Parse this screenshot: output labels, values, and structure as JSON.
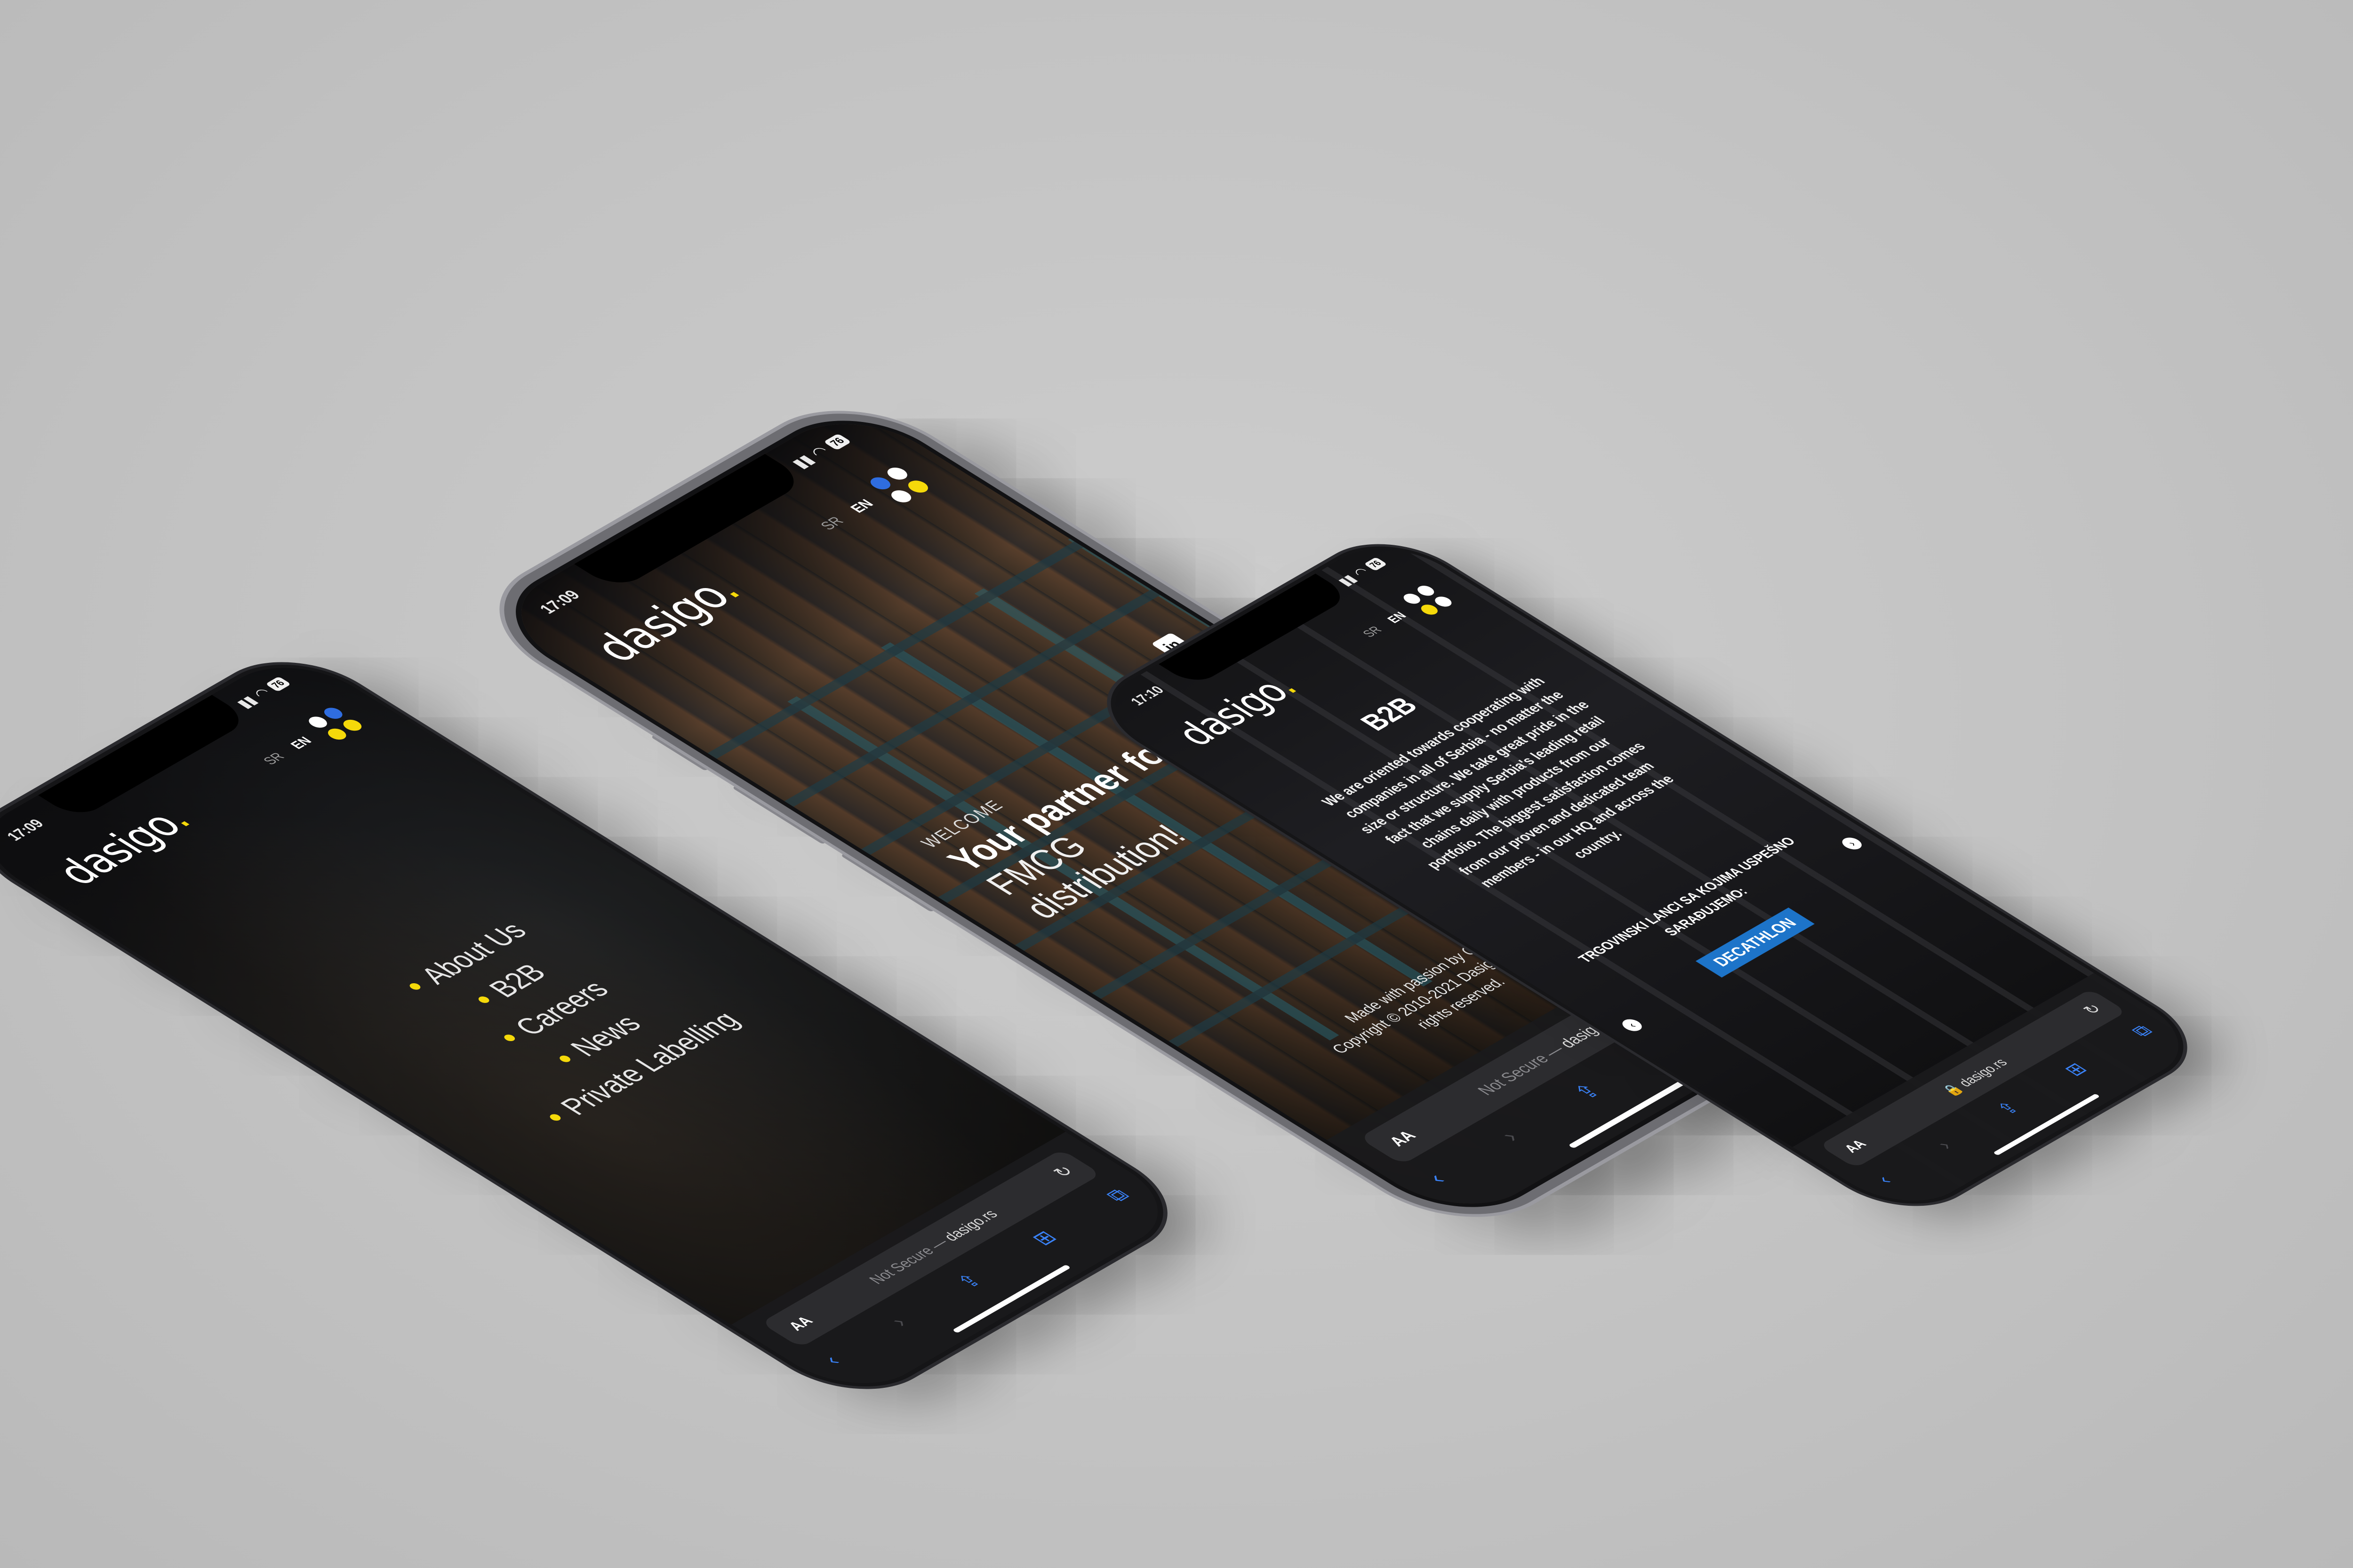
{
  "phones": [
    {
      "status": {
        "time": "17:09",
        "battery": "76"
      },
      "header": {
        "logo_text": "dasigo",
        "logo_dot": ".",
        "lang_sr": "SR",
        "lang_en": "EN"
      },
      "menu": {
        "items": [
          {
            "label": "About Us"
          },
          {
            "label": "B2B"
          },
          {
            "label": "Careers"
          },
          {
            "label": "News"
          },
          {
            "label": "Private Labelling"
          }
        ]
      },
      "safari": {
        "aa": "AA",
        "url_prefix": "Not Secure — ",
        "url_host": "dasigo.rs"
      }
    },
    {
      "status": {
        "time": "17:09",
        "battery": "76"
      },
      "header": {
        "logo_text": "dasigo",
        "logo_dot": ".",
        "lang_sr": "SR",
        "lang_en": "EN"
      },
      "hero": {
        "welcome": "WELCOME",
        "headline_bold": "Your partner for",
        "headline_line2": "FMCG",
        "headline_line3": "distribution!"
      },
      "footer": {
        "line1": "Made with passion by Origo",
        "line2": "Copyright © 2010-2021 Dasigo d.o.o. All",
        "line3": "rights reserved."
      },
      "safari": {
        "aa": "AA",
        "url_prefix": "Not Secure — ",
        "url_host": "dasigo.rs"
      }
    },
    {
      "status": {
        "time": "17:10",
        "battery": "76"
      },
      "header": {
        "logo_text": "dasigo",
        "logo_dot": ".",
        "lang_sr": "SR",
        "lang_en": "EN"
      },
      "b2b": {
        "title": "B2B",
        "body": "We are oriented towards cooperating with companies in all of Serbia - no matter the size or structure. We take great pride in the fact that we supply Serbia's leading retail chains daily with products from our portfolio. The biggest satisfaction comes from our proven and dedicated team members - in our HQ and across the country.",
        "subtitle": "TRGOVINSKI LANCI SA KOJIMA USPEŠNO SARAĐUJEMO:",
        "brand": "DECATHLON"
      },
      "safari": {
        "aa": "AA",
        "url_prefix": "🔒 ",
        "url_host": "dasigo.rs"
      }
    }
  ],
  "icons": {
    "linkedin": "in",
    "facebook": "f",
    "instagram": "◎",
    "reload": "↻",
    "back": "‹",
    "forward": "›",
    "share": "⇪",
    "bookmarks": "⊞",
    "tabs": "⧉",
    "arrow_left": "‹",
    "arrow_right": "›"
  },
  "colors": {
    "brand_yellow": "#f5d90a",
    "brand_blue": "#2f6de0",
    "safari_blue": "#3a82f7",
    "decathlon_blue": "#1d74c9"
  }
}
